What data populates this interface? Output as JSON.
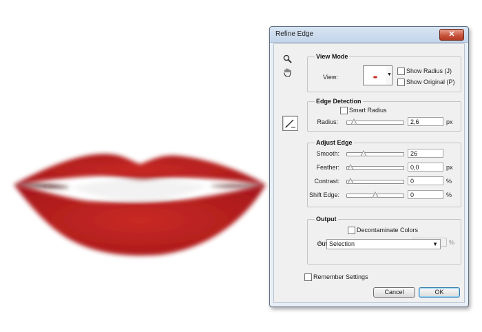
{
  "dialog": {
    "title": "Refine Edge",
    "close_glyph": "✕"
  },
  "tools": {
    "zoom_icon": "magnifier-icon",
    "hand_icon": "hand-icon",
    "brush_icon": "refine-radius-brush-icon"
  },
  "view_mode": {
    "legend": "View Mode",
    "view_label": "View:",
    "show_radius": "Show Radius (J)",
    "show_original": "Show Original (P)"
  },
  "edge_detection": {
    "legend": "Edge Detection",
    "smart_radius": "Smart Radius",
    "radius_label": "Radius:",
    "radius_value": "2,6",
    "radius_unit": "px",
    "radius_slider": 0.07
  },
  "adjust_edge": {
    "legend": "Adjust Edge",
    "smooth_label": "Smooth:",
    "smooth_value": "26",
    "smooth_slider": 0.26,
    "feather_label": "Feather:",
    "feather_value": "0,0",
    "feather_unit": "px",
    "feather_slider": 0.0,
    "contrast_label": "Contrast:",
    "contrast_value": "0",
    "contrast_unit": "%",
    "contrast_slider": 0.0,
    "shift_label": "Shift Edge:",
    "shift_value": "0",
    "shift_unit": "%",
    "shift_slider": 0.5
  },
  "output": {
    "legend": "Output",
    "decontaminate": "Decontaminate Colors",
    "amount_label": "Amount:",
    "amount_value": "",
    "amount_unit": "%",
    "output_to_label": "Output To:",
    "output_to_value": "Selection"
  },
  "remember_settings": "Remember Settings",
  "buttons": {
    "cancel": "Cancel",
    "ok": "OK"
  }
}
